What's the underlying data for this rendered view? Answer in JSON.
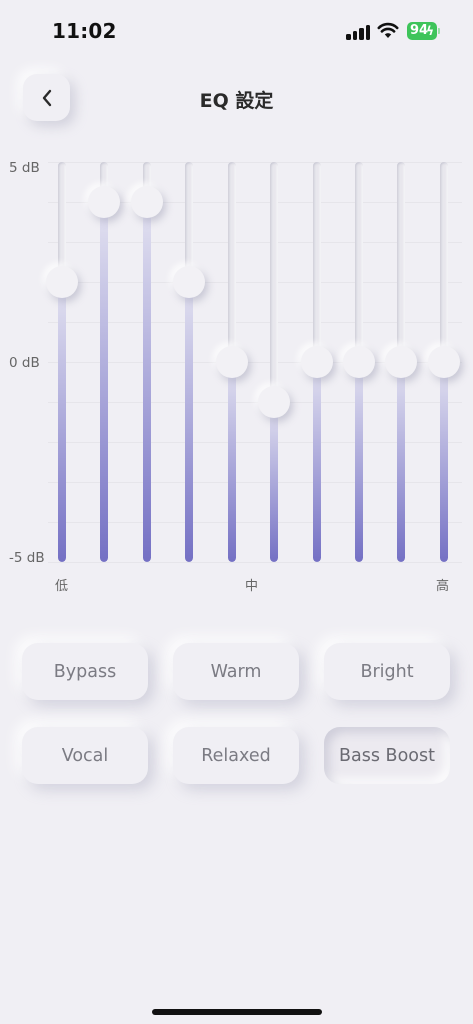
{
  "status_bar": {
    "time": "11:02",
    "battery": "94",
    "battery_color": "#3ec45a"
  },
  "header": {
    "back_icon": "chevron-left-icon",
    "title": "EQ 設定"
  },
  "eq": {
    "db_labels": {
      "max": "5 dB",
      "mid": "0 dB",
      "min": "-5 dB"
    },
    "freq_labels": {
      "low": "低",
      "mid": "中",
      "high": "高"
    },
    "range": [
      -5,
      5
    ],
    "bands_db": [
      2,
      4,
      4,
      2,
      0,
      -1,
      0,
      0,
      0,
      0
    ],
    "fill_color_top": "#e4e3f1",
    "fill_color_bottom": "#7470c4"
  },
  "presets": {
    "items": [
      {
        "label": "Bypass",
        "active": false
      },
      {
        "label": "Warm",
        "active": false
      },
      {
        "label": "Bright",
        "active": false
      },
      {
        "label": "Vocal",
        "active": false
      },
      {
        "label": "Relaxed",
        "active": false
      },
      {
        "label": "Bass Boost",
        "active": true
      }
    ]
  }
}
